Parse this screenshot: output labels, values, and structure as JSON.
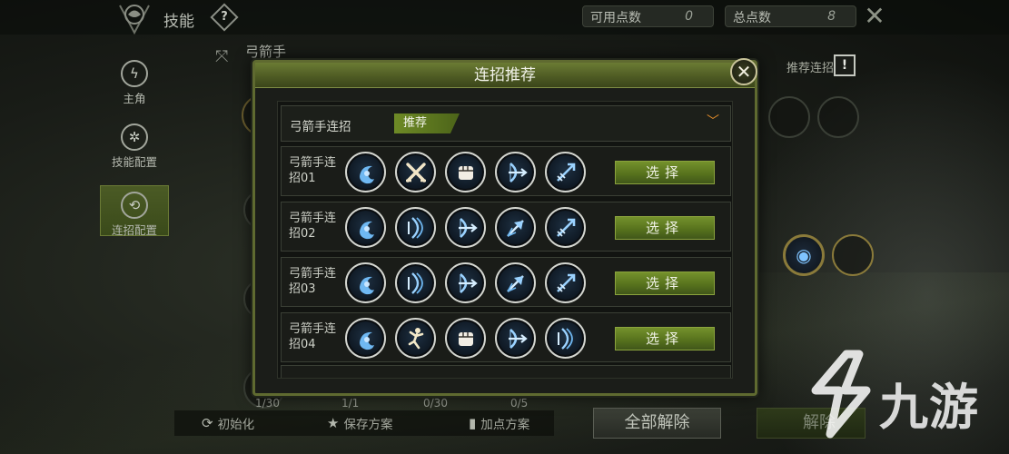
{
  "topbar": {
    "title": "技能",
    "help": "?",
    "available_points_label": "可用点数",
    "available_points": "0",
    "total_points_label": "总点数",
    "total_points": "8"
  },
  "sidebar": {
    "items": [
      {
        "label": "主角",
        "icon": "lightning-icon"
      },
      {
        "label": "技能配置",
        "icon": "swirl-icon"
      },
      {
        "label": "连招配置",
        "icon": "combo-icon",
        "active": true
      }
    ]
  },
  "class_name": "弓箭手",
  "recommend_combo_label": "推荐连招",
  "recommend_badge": "!",
  "counters": [
    "1/30",
    "1/1",
    "0/30",
    "0/5"
  ],
  "bottom_actions": {
    "reset": "初始化",
    "save_plan": "保存方案",
    "add_point_plan": "加点方案",
    "unlock_all": "全部解除",
    "unlock_partial": "解除"
  },
  "modal": {
    "title": "连招推荐",
    "close": "✕",
    "selector_label": "弓箭手连招",
    "selector_tag": "推荐",
    "combos": [
      {
        "name": "弓箭手连招01",
        "skills": [
          "wave-icon",
          "crossed-swords-icon",
          "fist-icon",
          "bow-icon",
          "arrow-icon"
        ],
        "button": "选择"
      },
      {
        "name": "弓箭手连招02",
        "skills": [
          "wave-icon",
          "multi-bow-icon",
          "bow-icon",
          "spread-arrow-icon",
          "arrow-icon"
        ],
        "button": "选择"
      },
      {
        "name": "弓箭手连招03",
        "skills": [
          "wave-icon",
          "multi-bow-icon",
          "bow-icon",
          "spread-arrow-icon",
          "arrow-icon"
        ],
        "button": "选择"
      },
      {
        "name": "弓箭手连招04",
        "skills": [
          "wave-icon",
          "dodge-figure-icon",
          "fist-icon",
          "bow-icon",
          "multi-bow-icon"
        ],
        "button": "选择"
      }
    ]
  },
  "watermark": {
    "text": "九游"
  },
  "colors": {
    "accent_green": "#5c7424",
    "icon_blue": "#7fc4ff",
    "chevron_orange": "#e08b2a"
  }
}
